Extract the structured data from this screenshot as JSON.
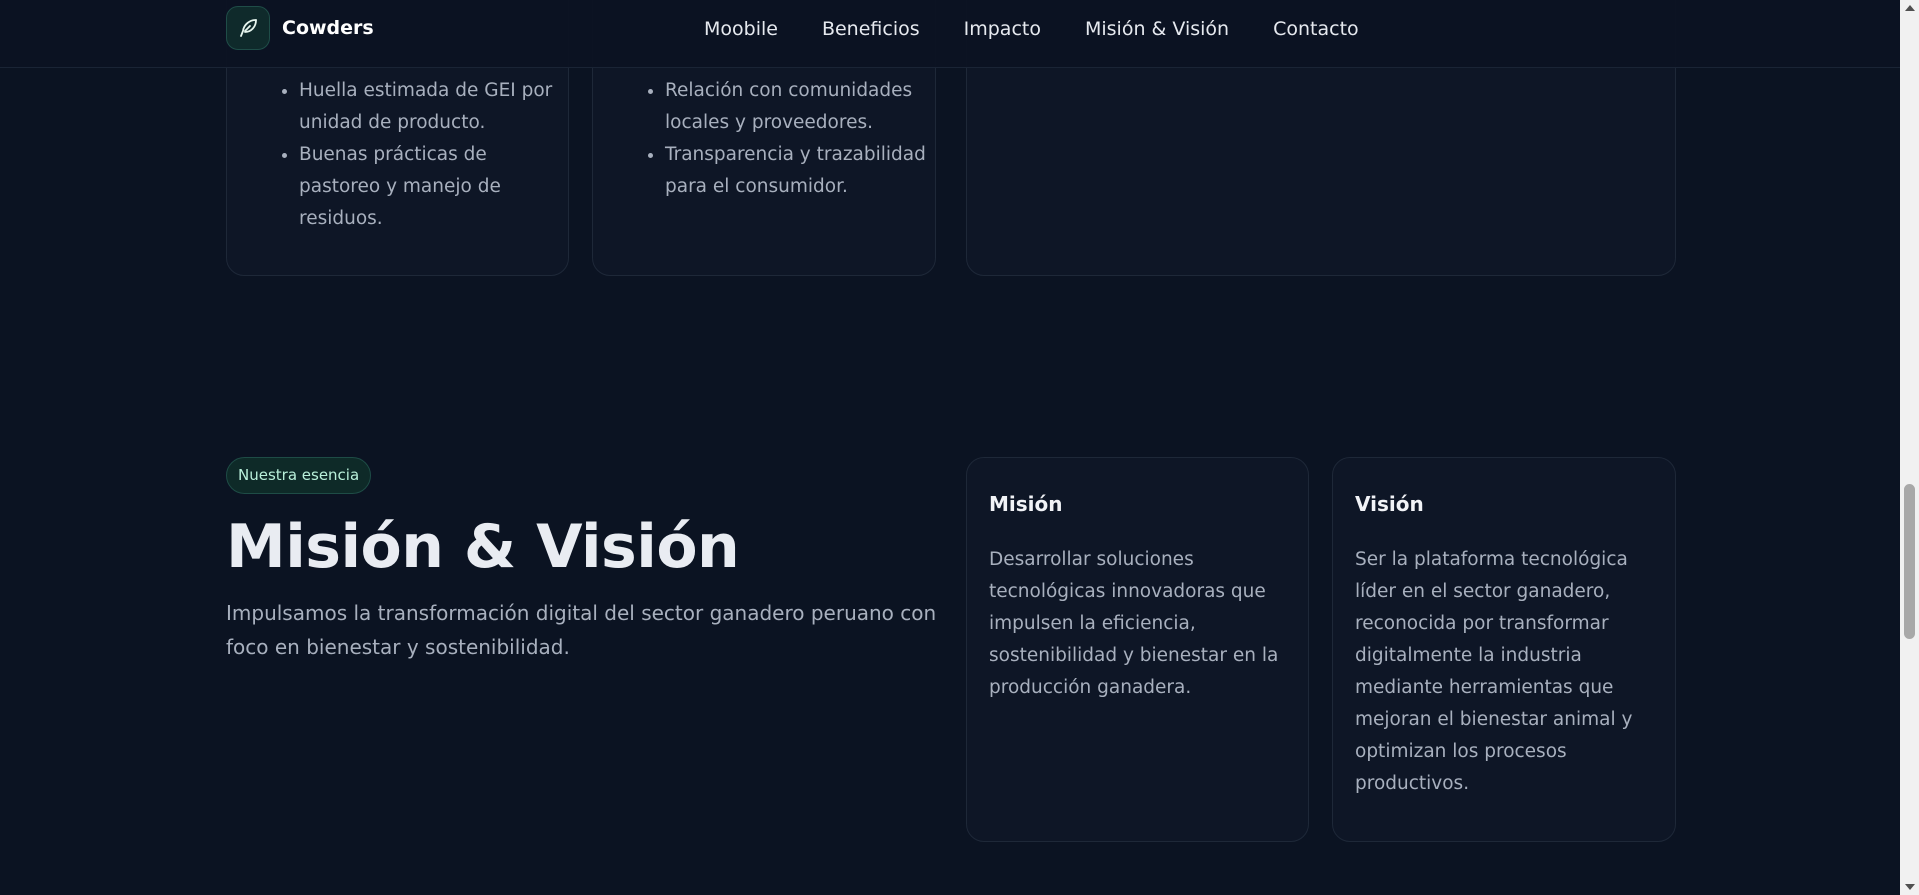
{
  "brand": {
    "name": "Cowders",
    "icon": "feather-icon"
  },
  "nav": {
    "items": [
      {
        "label": "Moobile"
      },
      {
        "label": "Beneficios"
      },
      {
        "label": "Impacto"
      },
      {
        "label": "Misión & Visión"
      },
      {
        "label": "Contacto"
      }
    ]
  },
  "impact_cards": {
    "card1_items": [
      "Huella estimada de GEI por unidad de producto.",
      "Buenas prácticas de pastoreo y manejo de residuos."
    ],
    "card2_items": [
      "Relación con comunidades locales y proveedores.",
      "Transparencia y trazabilidad para el consumidor."
    ]
  },
  "mission_section": {
    "badge": "Nuestra esencia",
    "title": "Misión & Visión",
    "description": "Impulsamos la transformación digital del sector ganadero peruano con foco en bienestar y sostenibilidad.",
    "mission": {
      "title": "Misión",
      "text": "Desarrollar soluciones tecnológicas innovadoras que impulsen la eficiencia, sostenibilidad y bienestar en la producción ganadera."
    },
    "vision": {
      "title": "Visión",
      "text": "Ser la plataforma tecnológica líder en el sector ganadero, reconocida por transformar digitalmente la industria mediante herramientas que mejoran el bienestar animal y optimizan los procesos productivos."
    }
  },
  "colors": {
    "background": "#0b1322",
    "card": "#0e1626",
    "accent": "#b9f0da",
    "muted_text": "#a8b0be"
  }
}
